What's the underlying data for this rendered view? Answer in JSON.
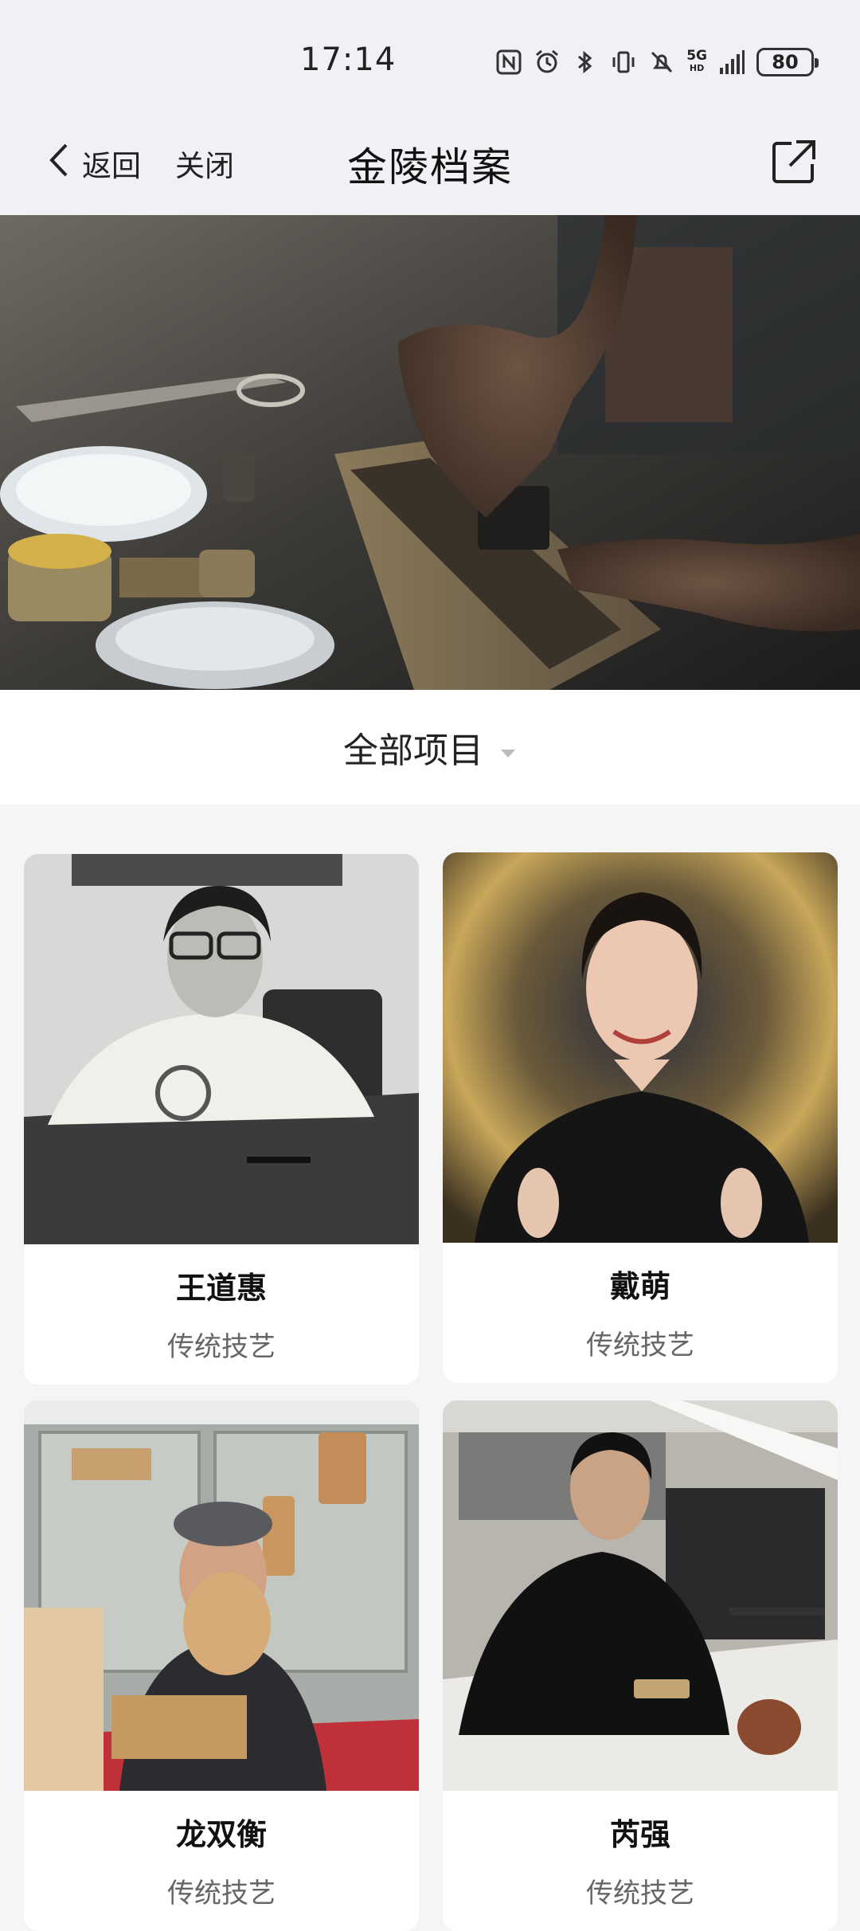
{
  "status_bar": {
    "time": "17:14",
    "network": "5G",
    "battery": "80",
    "icons": [
      "nfc-icon",
      "alarm-icon",
      "bluetooth-icon",
      "vibrate-icon",
      "mute-icon",
      "signal-icon"
    ]
  },
  "nav": {
    "back_label": "返回",
    "close_label": "关闭",
    "title": "金陵档案",
    "share_icon": "share-icon"
  },
  "filter": {
    "label": "全部项目",
    "icon": "dropdown-triangle-icon"
  },
  "cards": [
    {
      "name": "王道惠",
      "category": "传统技艺"
    },
    {
      "name": "戴萌",
      "category": "传统技艺"
    },
    {
      "name": "龙双衡",
      "category": "传统技艺"
    },
    {
      "name": "芮强",
      "category": "传统技艺"
    }
  ]
}
